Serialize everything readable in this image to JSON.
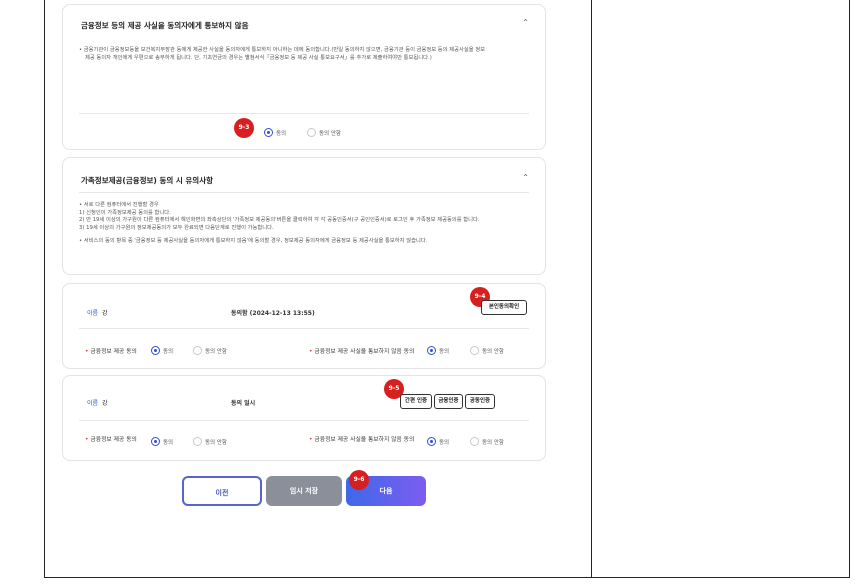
{
  "section1": {
    "title": "금융정보 등의 제공 사실을 동의자에게 통보하지 않음",
    "text_line1": "• 금융기관이 금융정보등을 보건복지부장관 등에게 제공한 사실을 동의자에게 통보하지 아니하는 데에 동의합니다.(만일 동의하지 않으면, 금융기관 등이 금융정보 등의 제공사실을 정보",
    "text_line2": "제공 동의자 개인에게 우편으로 송부하게 됩니다. 단, 기초연금의 경우는 별첨서식「금융정보 등 제공 사실 통보요구서」를 추가로 제출하여야만 통보됩니다.)",
    "badge": "9-3",
    "agree": "동의",
    "disagree": "동의 안함"
  },
  "section2": {
    "title": "가족정보제공(금융정보) 동의 시 유의사항",
    "lines": [
      "• 서로 다른 컴퓨터에서 진행할 경우",
      "1) 신청인이 가족정보제공 동의를 합니다.",
      "2) 만 19세 이상의 가구원이 다른 컴퓨터에서 해인화면의 좌측상단의 '가족정보 제공동의'버튼을 클릭하여 각 각 공동인증서(구 공인인증서)로 로그인 후 가족정보 제공동의를 합니다.",
      "3) 19세 이상의 가구원의 정보제공동의가 모두 완료되면 다음단계로 진행이 가능합니다.",
      "• 서비스의 동의 항목 중 '금융정보 등 제공사실을 동의자에게 통보하지 않음'에 동의할 경우, 정보제공 동의자에게 금융정보 등 제공사실을 통보하지 않습니다."
    ]
  },
  "person1": {
    "name_key": "이름",
    "name_val": "강",
    "status": "동의함 (2024-12-13 13:55)",
    "badge": "9-4",
    "confirm_btn": "본인동의확인",
    "q1": "금융정보 제공 동의",
    "q2": "금융정보 제공 사실을 통보하지 않음 동의",
    "agree": "동의",
    "disagree": "동의 안함"
  },
  "person2": {
    "name_key": "이름",
    "name_val": "강",
    "status": "동의 일시",
    "badge": "9-5",
    "btn1": "간편 인증",
    "btn2": "금융인증",
    "btn3": "공동인증",
    "q1": "금융정보 제공 동의",
    "q2": "금융정보 제공 사실을 통보하지 않음 동의",
    "agree": "동의",
    "disagree": "동의 안함"
  },
  "footer": {
    "prev": "이전",
    "save": "임시 저장",
    "next": "다음",
    "badge": "9-6"
  }
}
